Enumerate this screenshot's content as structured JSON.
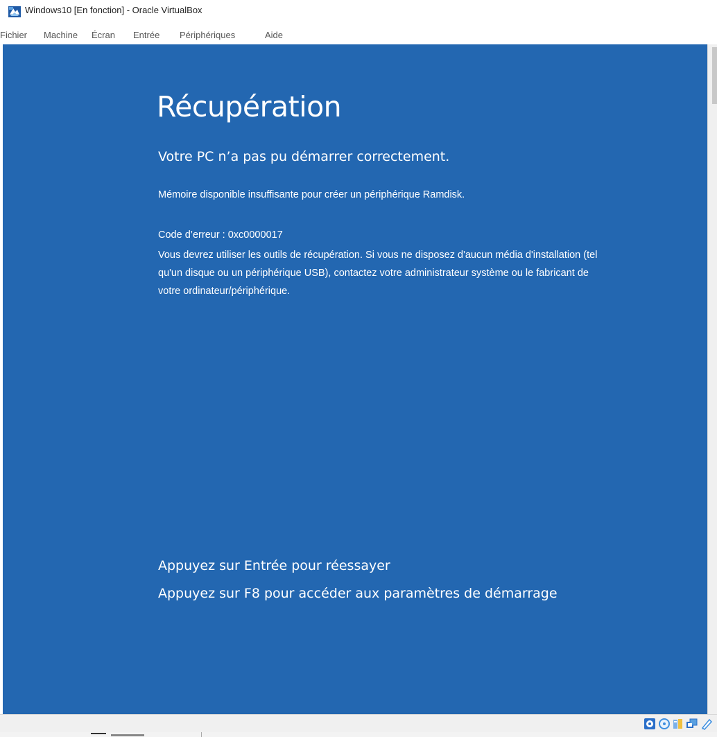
{
  "window": {
    "title": "Windows10 [En fonction] - Oracle VirtualBox"
  },
  "menubar": {
    "items": [
      "Fichier",
      "Machine",
      "Écran",
      "Entrée",
      "Périphériques",
      "Aide"
    ]
  },
  "vm_screen": {
    "background": "#2367b1",
    "title": "Récupération",
    "subtitle": "Votre PC n’a pas pu démarrer correctement.",
    "message": "Mémoire disponible insuffisante pour créer un périphérique Ramdisk.",
    "error_code": "Code d’erreur : 0xc0000017",
    "instructions": [
      "Vous devrez utiliser les outils de récupération. Si vous ne disposez d'aucun média d'installation (tel",
      "qu'un disque ou un périphérique USB), contactez votre administrateur système ou le fabricant de",
      "votre ordinateur/périphérique."
    ],
    "actions": [
      "Appuyez sur Entrée pour réessayer",
      "Appuyez sur F8 pour accéder aux paramètres de démarrage"
    ]
  },
  "statusbar": {
    "icons": [
      "hard-disk-icon",
      "optical-drive-icon",
      "usb-icon",
      "network-icon",
      "shared-folders-icon"
    ]
  }
}
